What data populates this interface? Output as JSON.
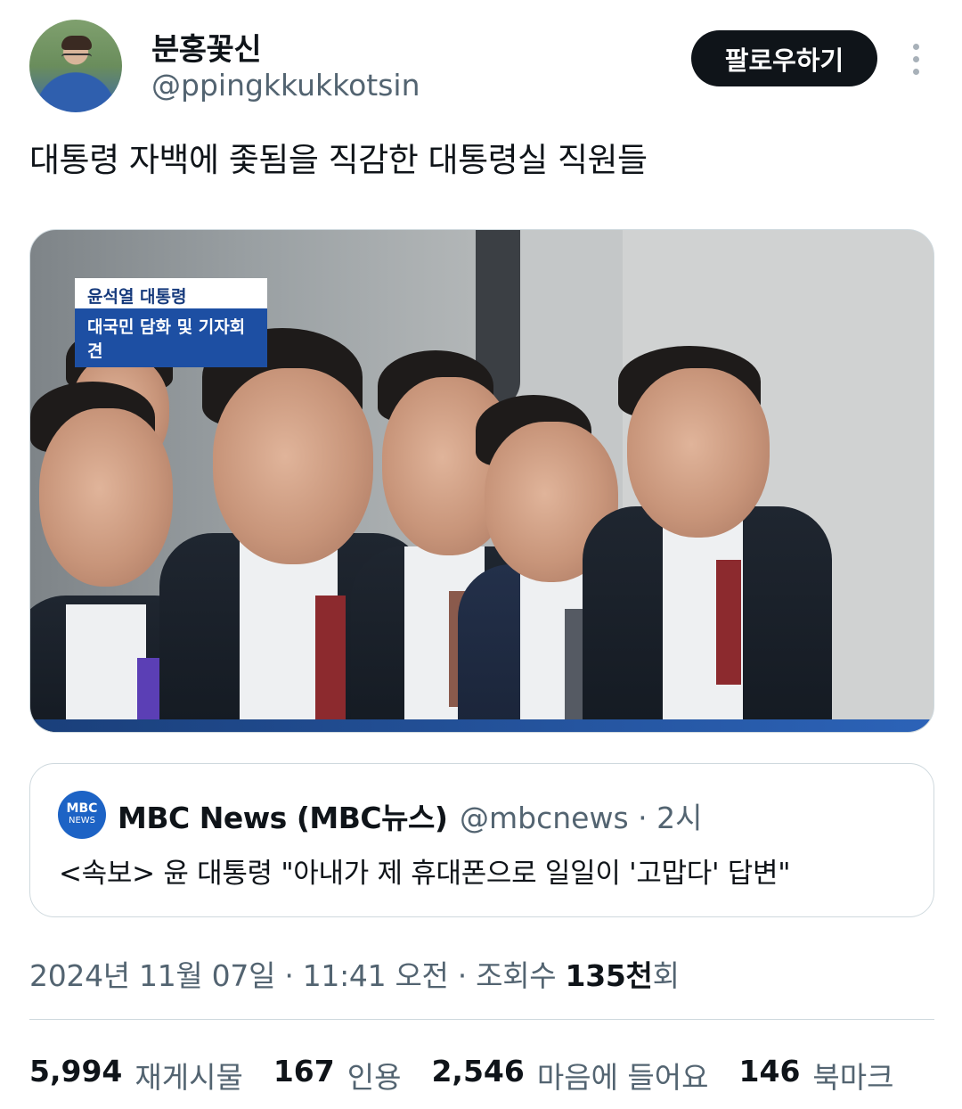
{
  "author": {
    "display_name": "분홍꽃신",
    "handle": "@ppingkkukkotsin",
    "follow_label": "팔로우하기"
  },
  "tweet": {
    "text": "대통령 자백에 좇됨을 직감한 대통령실 직원들"
  },
  "media": {
    "caption_top": "윤석열 대통령",
    "caption_bottom": "대국민 담화 및 기자회견"
  },
  "quote": {
    "logo_top": "MBC",
    "logo_bottom": "NEWS",
    "name": "MBC News (MBC뉴스)",
    "handle_time": "@mbcnews · 2시",
    "text": "<속보> 윤 대통령 \"아내가 제 휴대폰으로 일일이 '고맙다' 답변\""
  },
  "meta": {
    "datetime": "2024년 11월 07일 · 11:41 오전 · 조회수 ",
    "views_num": "135천",
    "views_suffix": "회"
  },
  "stats": [
    {
      "num": "5,994",
      "label": "재게시물"
    },
    {
      "num": "167",
      "label": "인용"
    },
    {
      "num": "2,546",
      "label": "마음에 들어요"
    },
    {
      "num": "146",
      "label": "북마크"
    }
  ],
  "colors": {
    "text_primary": "#0f1419",
    "text_secondary": "#536471",
    "border": "#cfd9de",
    "follow_bg": "#0f1419",
    "mbc_blue": "#1d63c5"
  }
}
